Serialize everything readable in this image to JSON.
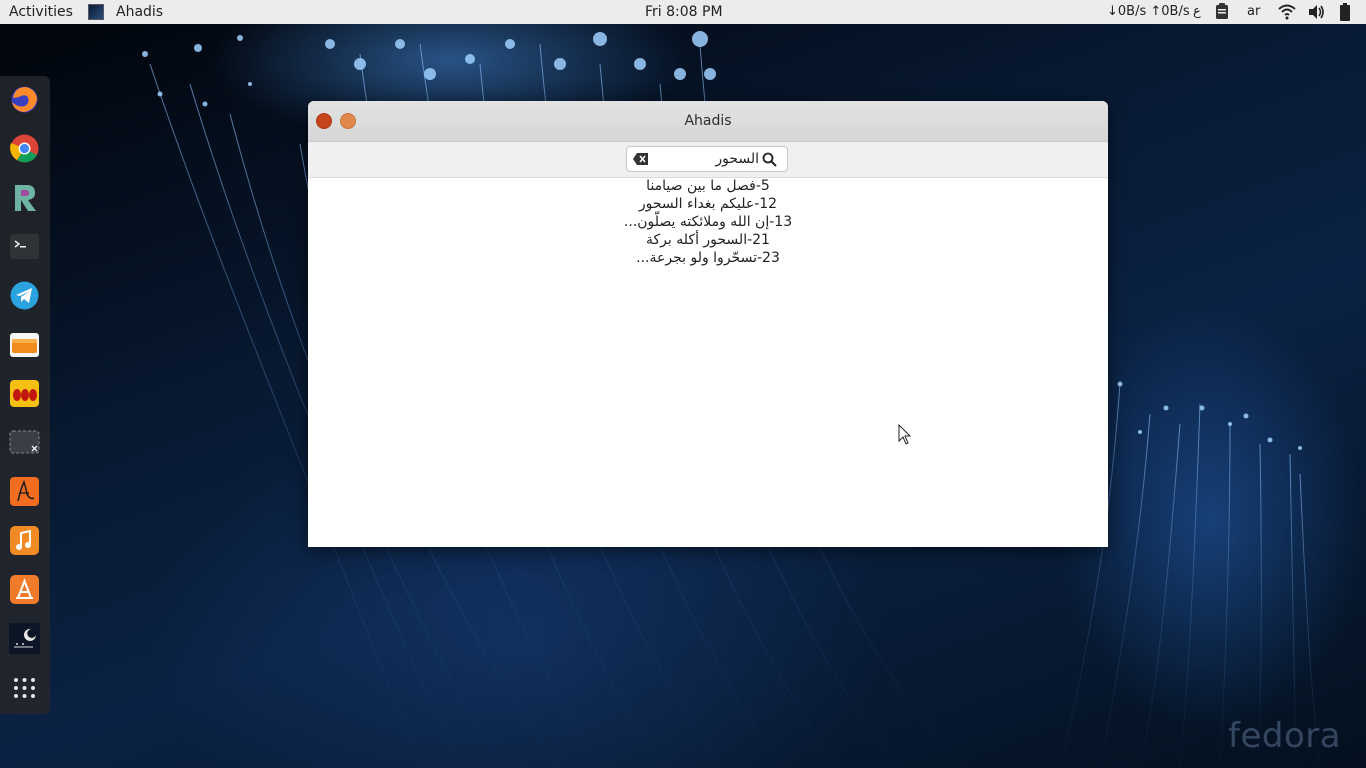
{
  "topbar": {
    "activities": "Activities",
    "app_name": "Ahadis",
    "clock": "Fri  8:08 PM",
    "netspeed": "↓0B/s ↑0B/s",
    "keyboard_layout": "ع",
    "lang": "ar"
  },
  "dock": {
    "items": [
      "firefox-icon",
      "chrome-icon",
      "rstudio-icon",
      "terminal-icon",
      "telegram-icon",
      "files-icon",
      "slides-icon",
      "screenshot-icon",
      "acrobat-icon",
      "music-icon",
      "software-store-icon",
      "ahadis-icon",
      "show-apps-icon"
    ]
  },
  "window": {
    "title": "Ahadis",
    "search": {
      "value": "السحور"
    },
    "results": [
      "5-فصل ما بين صيامنا",
      "12-عليكم بغداء السحور",
      "13-إن الله وملائكته يصلّون...",
      "21-السحور أكله بركة",
      "23-تسحّروا ولو بجرعة..."
    ]
  },
  "wallpaper": {
    "watermark": "fedora"
  },
  "colors": {
    "close": "#c8441a",
    "minimize": "#e2884c",
    "topbar": "#ececec"
  }
}
